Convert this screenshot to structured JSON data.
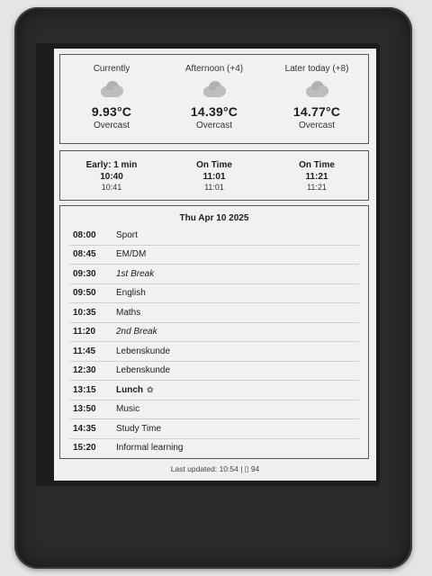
{
  "weather": [
    {
      "label": "Currently",
      "icon": "cloud-icon",
      "temp": "9.93°C",
      "condition": "Overcast"
    },
    {
      "label": "Afternoon (+4)",
      "icon": "cloud-icon",
      "temp": "14.39°C",
      "condition": "Overcast"
    },
    {
      "label": "Later today (+8)",
      "icon": "cloud-icon",
      "temp": "14.77°C",
      "condition": "Overcast"
    }
  ],
  "trains": [
    {
      "status": "Early: 1 min",
      "scheduled": "10:40",
      "actual": "10:41"
    },
    {
      "status": "On Time",
      "scheduled": "11:01",
      "actual": "11:01"
    },
    {
      "status": "On Time",
      "scheduled": "11:21",
      "actual": "11:21"
    }
  ],
  "schedule": {
    "date": "Thu Apr 10 2025",
    "items": [
      {
        "time": "08:00",
        "subject": "Sport",
        "style": "normal"
      },
      {
        "time": "08:45",
        "subject": "EM/DM",
        "style": "normal"
      },
      {
        "time": "09:30",
        "subject": "1st Break",
        "style": "italic"
      },
      {
        "time": "09:50",
        "subject": "English",
        "style": "normal"
      },
      {
        "time": "10:35",
        "subject": "Maths",
        "style": "normal"
      },
      {
        "time": "11:20",
        "subject": "2nd Break",
        "style": "italic"
      },
      {
        "time": "11:45",
        "subject": "Lebenskunde",
        "style": "normal"
      },
      {
        "time": "12:30",
        "subject": "Lebenskunde",
        "style": "normal"
      },
      {
        "time": "13:15",
        "subject": "Lunch",
        "style": "bold",
        "icon": "leaf-icon"
      },
      {
        "time": "13:50",
        "subject": "Music",
        "style": "normal"
      },
      {
        "time": "14:35",
        "subject": "Study Time",
        "style": "normal"
      },
      {
        "time": "15:20",
        "subject": "Informal learning",
        "style": "normal"
      }
    ]
  },
  "footer": "Last updated: 10:54 | ▯ 94"
}
